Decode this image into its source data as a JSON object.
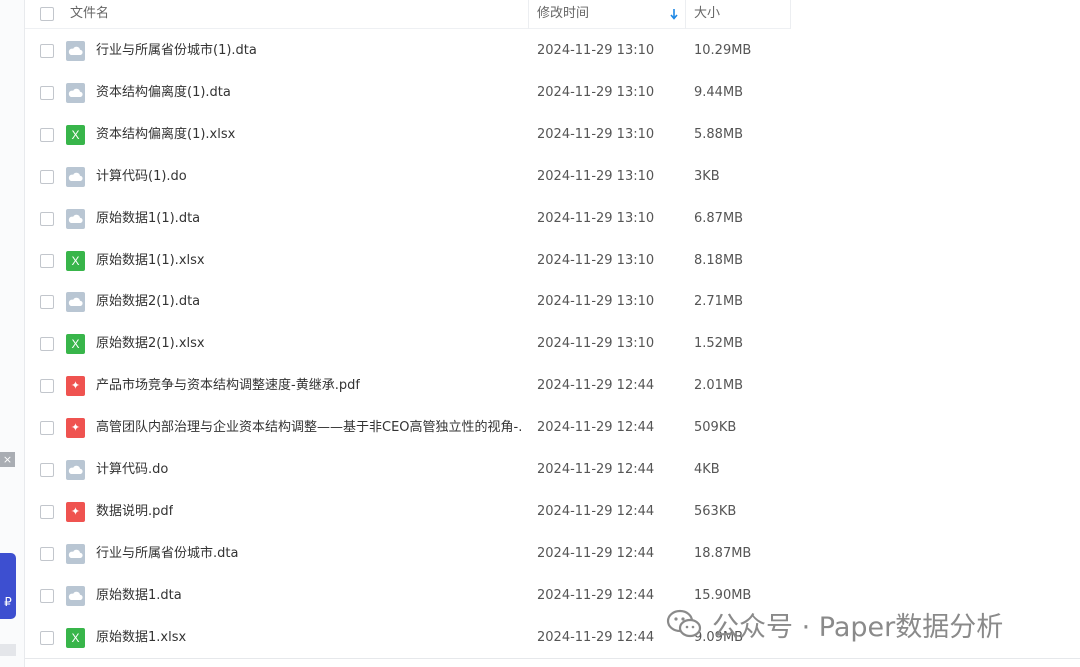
{
  "header": {
    "name_label": "文件名",
    "time_label": "修改时间",
    "size_label": "大小"
  },
  "files": [
    {
      "name": "行业与所属省份城市(1).dta",
      "time": "2024-11-29 13:10",
      "size": "10.29MB",
      "type": "cloud"
    },
    {
      "name": "资本结构偏离度(1).dta",
      "time": "2024-11-29 13:10",
      "size": "9.44MB",
      "type": "cloud"
    },
    {
      "name": "资本结构偏离度(1).xlsx",
      "time": "2024-11-29 13:10",
      "size": "5.88MB",
      "type": "excel"
    },
    {
      "name": "计算代码(1).do",
      "time": "2024-11-29 13:10",
      "size": "3KB",
      "type": "cloud"
    },
    {
      "name": "原始数据1(1).dta",
      "time": "2024-11-29 13:10",
      "size": "6.87MB",
      "type": "cloud"
    },
    {
      "name": "原始数据1(1).xlsx",
      "time": "2024-11-29 13:10",
      "size": "8.18MB",
      "type": "excel"
    },
    {
      "name": "原始数据2(1).dta",
      "time": "2024-11-29 13:10",
      "size": "2.71MB",
      "type": "cloud"
    },
    {
      "name": "原始数据2(1).xlsx",
      "time": "2024-11-29 13:10",
      "size": "1.52MB",
      "type": "excel"
    },
    {
      "name": "产品市场竞争与资本结构调整速度-黄继承.pdf",
      "time": "2024-11-29 12:44",
      "size": "2.01MB",
      "type": "pdf"
    },
    {
      "name": "高管团队内部治理与企业资本结构调整——基于非CEO高管独立性的视角-...",
      "time": "2024-11-29 12:44",
      "size": "509KB",
      "type": "pdf"
    },
    {
      "name": "计算代码.do",
      "time": "2024-11-29 12:44",
      "size": "4KB",
      "type": "cloud"
    },
    {
      "name": "数据说明.pdf",
      "time": "2024-11-29 12:44",
      "size": "563KB",
      "type": "pdf"
    },
    {
      "name": "行业与所属省份城市.dta",
      "time": "2024-11-29 12:44",
      "size": "18.87MB",
      "type": "cloud"
    },
    {
      "name": "原始数据1.dta",
      "time": "2024-11-29 12:44",
      "size": "15.90MB",
      "type": "cloud"
    },
    {
      "name": "原始数据1.xlsx",
      "time": "2024-11-29 12:44",
      "size": "9.09MB",
      "type": "excel"
    }
  ],
  "icons": {
    "cloud": "cloud-file-icon",
    "excel": "excel-file-icon",
    "pdf": "pdf-file-icon"
  },
  "colors": {
    "accent": "#1e88e5",
    "cloud_icon": "#b9c6d3",
    "excel_icon": "#38b54a",
    "pdf_icon": "#ef5350"
  },
  "left_panel": {
    "close_glyph": "×",
    "app_glyph": "₽"
  },
  "watermark": {
    "text": "公众号 · Paper数据分析"
  }
}
